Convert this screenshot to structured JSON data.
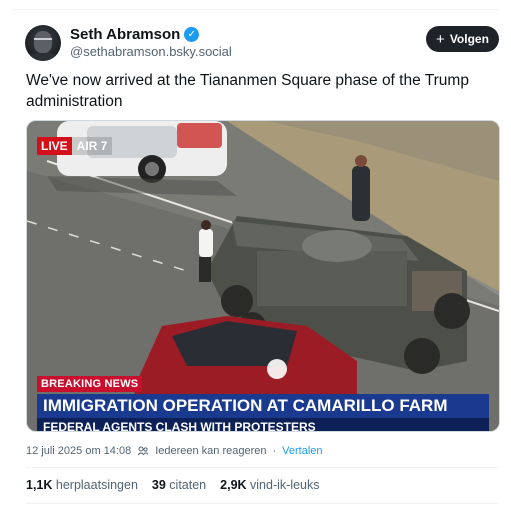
{
  "author": {
    "name": "Seth Abramson",
    "handle": "@sethabramson.bsky.social",
    "verified_icon": "check-icon"
  },
  "follow_button": {
    "label": "Volgen",
    "icon": "plus-icon"
  },
  "post": {
    "text": "We've now arrived at the Tiananmen Square phase of the Trump administration"
  },
  "media": {
    "live_label": "LIVE",
    "air_label": "AIR 7",
    "breaking_label": "BREAKING NEWS",
    "headline": "IMMIGRATION OPERATION AT CAMARILLO FARM",
    "subheadline": "FEDERAL AGENTS CLASH WITH PROTESTERS"
  },
  "meta": {
    "timestamp": "12 juli 2025 om 14:08",
    "reply_setting": "Iedereen kan reageren",
    "translate_link": "Vertalen",
    "separator": "·"
  },
  "stats": {
    "reposts_count": "1,1K",
    "reposts_label": "herplaatsingen",
    "quotes_count": "39",
    "quotes_label": "citaten",
    "likes_count": "2,9K",
    "likes_label": "vind-ik-leuks"
  },
  "colors": {
    "accent": "#1d9bf0",
    "breaking_red": "#c8102e",
    "headline_blue": "#1a3a8f"
  }
}
